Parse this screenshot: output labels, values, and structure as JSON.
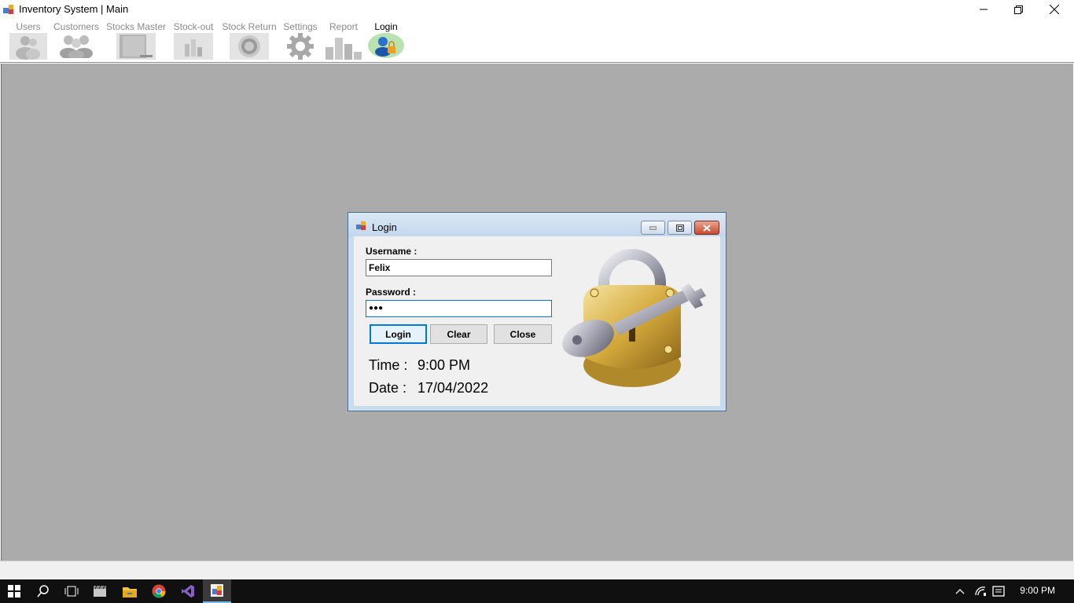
{
  "window": {
    "title": "Inventory System | Main"
  },
  "toolbar": {
    "items": [
      {
        "label": "Users",
        "icon": "users-icon",
        "enabled": false
      },
      {
        "label": "Customers",
        "icon": "customers-icon",
        "enabled": false
      },
      {
        "label": "Stocks Master",
        "icon": "stocks-master-icon",
        "enabled": false
      },
      {
        "label": "Stock-out",
        "icon": "stock-out-icon",
        "enabled": false
      },
      {
        "label": "Stock Return",
        "icon": "stock-return-icon",
        "enabled": false
      },
      {
        "label": "Settings",
        "icon": "gear-icon",
        "enabled": false
      },
      {
        "label": "Report",
        "icon": "bar-chart-icon",
        "enabled": false
      },
      {
        "label": "Login",
        "icon": "user-lock-icon",
        "enabled": true
      }
    ]
  },
  "login_dialog": {
    "title": "Login",
    "username_label": "Username :",
    "username_value": "Felix",
    "password_label": "Password :",
    "password_value": "●●●",
    "login_button": "Login",
    "clear_button": "Clear",
    "close_button": "Close",
    "time_label": "Time :",
    "time_value": "9:00 PM",
    "date_label": "Date :",
    "date_value": "17/04/2022",
    "image": "padlock-key-icon"
  },
  "taskbar": {
    "apps": [
      "windows-start-icon",
      "search-icon",
      "task-view-icon",
      "clapper-icon",
      "file-explorer-icon",
      "chrome-icon",
      "visual-studio-icon",
      "inventory-app-icon"
    ],
    "clock": "9:00 PM"
  },
  "colors": {
    "mdi_background": "#ababab",
    "dialog_frame": "#c9dcee",
    "accent": "#0078d7"
  }
}
